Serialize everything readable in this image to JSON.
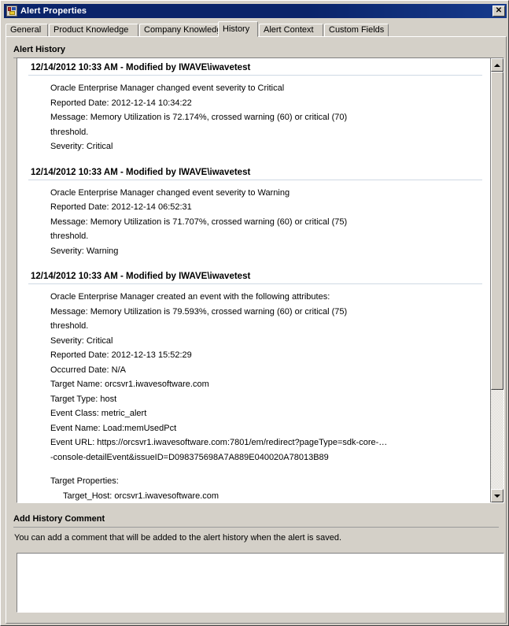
{
  "window": {
    "title": "Alert Properties",
    "icon": "app-properties-icon",
    "close_label": "✕"
  },
  "tabs": [
    {
      "label": "General",
      "active": false
    },
    {
      "label": "Product Knowledge",
      "active": false
    },
    {
      "label": "Company Knowledge",
      "active": false
    },
    {
      "label": "History",
      "active": true
    },
    {
      "label": "Alert Context",
      "active": false
    },
    {
      "label": "Custom Fields",
      "active": false
    }
  ],
  "history_section": {
    "header": "Alert History",
    "entries": [
      {
        "title": "12/14/2012 10:33 AM - Modified by IWAVE\\iwavetest",
        "lines": [
          "Oracle Enterprise Manager changed event severity to Critical",
          "Reported Date: 2012-12-14 10:34:22",
          "Message: Memory Utilization is 72.174%, crossed warning (60) or critical (70)",
          "threshold.",
          "Severity: Critical"
        ]
      },
      {
        "title": "12/14/2012 10:33 AM - Modified by IWAVE\\iwavetest",
        "lines": [
          "Oracle Enterprise Manager changed event severity to Warning",
          "Reported Date: 2012-12-14 06:52:31",
          "Message: Memory Utilization is 71.707%, crossed warning (60) or critical (75)",
          "threshold.",
          "Severity: Warning"
        ]
      },
      {
        "title": "12/14/2012 10:33 AM - Modified by IWAVE\\iwavetest",
        "lines": [
          "Oracle Enterprise Manager created an event with the following attributes:",
          "Message: Memory Utilization is 79.593%, crossed warning (60) or critical (75)",
          "threshold.",
          "Severity: Critical",
          "Reported Date: 2012-12-13 15:52:29",
          "Occurred Date: N/A",
          "Target Name: orcsvr1.iwavesoftware.com",
          "Target Type: host",
          "Event Class: metric_alert",
          "Event Name: Load:memUsedPct",
          "Event URL: https://orcsvr1.iwavesoftware.com:7801/em/redirect?pageType=sdk-core-…",
          "-console-detailEvent&issueID=D098375698A7A889E040020A78013B89",
          "",
          "Target Properties:"
        ],
        "indented_lines": [
          "Target_Host: orcsvr1.iwavesoftware.com"
        ]
      }
    ]
  },
  "comment_section": {
    "header": "Add History Comment",
    "hint": "You can add a comment that will be added to the alert history when the alert is saved.",
    "value": "",
    "placeholder": ""
  },
  "scrollbar": {
    "up_arrow": "scroll-up-arrow-icon",
    "down_arrow": "scroll-down-arrow-icon"
  },
  "colors": {
    "titlebar": "#0a246a",
    "face": "#d4d0c8",
    "field": "#ffffff",
    "text": "#000000"
  }
}
